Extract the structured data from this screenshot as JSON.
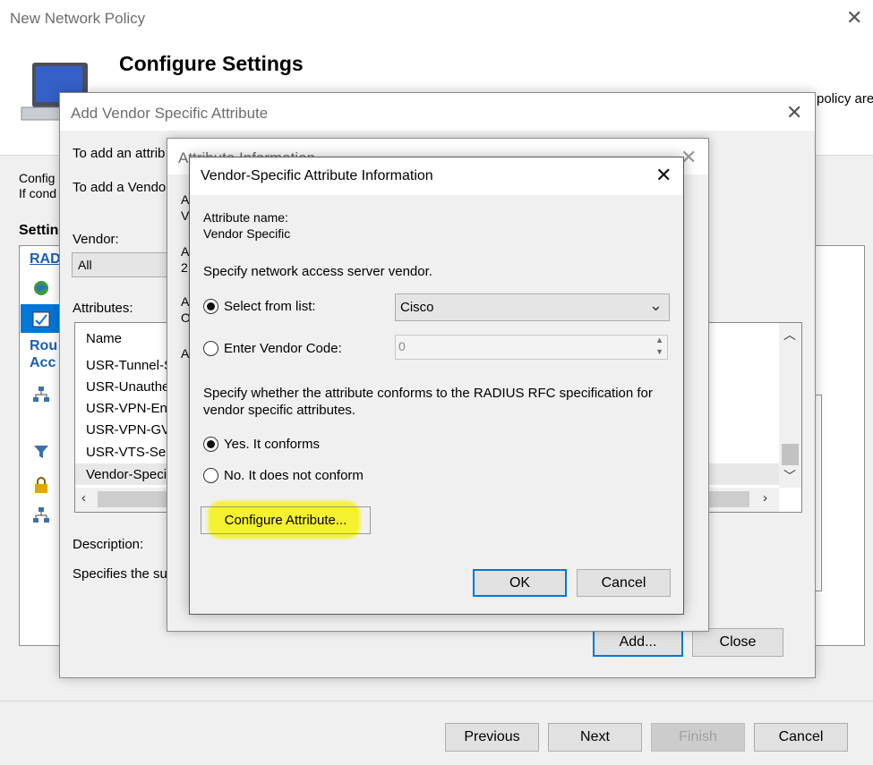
{
  "main_window": {
    "title": "New Network Policy",
    "heading": "Configure Settings",
    "header_text_fragment": "policy are",
    "body_text_line1": "Config",
    "body_text_line2": "If cond",
    "settings_label": "Settin",
    "side_section1": "RAD",
    "side_section2_line1": "Rou",
    "side_section2_line2": "Acc",
    "buttons": {
      "previous": "Previous",
      "next": "Next",
      "finish": "Finish",
      "cancel": "Cancel"
    }
  },
  "add_vsa_dialog": {
    "title": "Add Vendor Specific Attribute",
    "line1": "To add an attrib",
    "line2": "To add a Vendo",
    "vendor_label": "Vendor:",
    "vendor_value": "All",
    "attributes_label": "Attributes:",
    "list_header": "Name",
    "list_items": [
      "USR-Tunnel-S",
      "USR-Unauthe",
      "USR-VPN-En",
      "USR-VPN-GV",
      "USR-VTS-Se",
      "Vendor-Speci"
    ],
    "description_label": "Description:",
    "description_text": "Specifies the su",
    "add_button": "Add...",
    "close_button": "Close"
  },
  "attribute_info_dialog": {
    "title": "Attribute Information",
    "fragments": [
      "A",
      "V",
      "A",
      "2",
      "A",
      "O",
      "A"
    ]
  },
  "vsa_info_dialog": {
    "title": "Vendor-Specific Attribute Information",
    "attr_name_label": "Attribute name:",
    "attr_name_value": "Vendor Specific",
    "specify_vendor": "Specify network access server vendor.",
    "radio_select_list": "Select from list:",
    "vendor_select_value": "Cisco",
    "radio_enter_code": "Enter Vendor Code:",
    "vendor_code_value": "0",
    "conform_question": "Specify whether the attribute conforms to the RADIUS RFC specification for vendor specific attributes.",
    "radio_yes": "Yes. It conforms",
    "radio_no": "No. It does not conform",
    "configure_button": "Configure Attribute...",
    "ok_button": "OK",
    "cancel_button": "Cancel"
  },
  "colors": {
    "accent_blue": "#0078d7",
    "highlight_yellow": "#f5f21a",
    "dialog_bg": "#f0f0f0"
  }
}
